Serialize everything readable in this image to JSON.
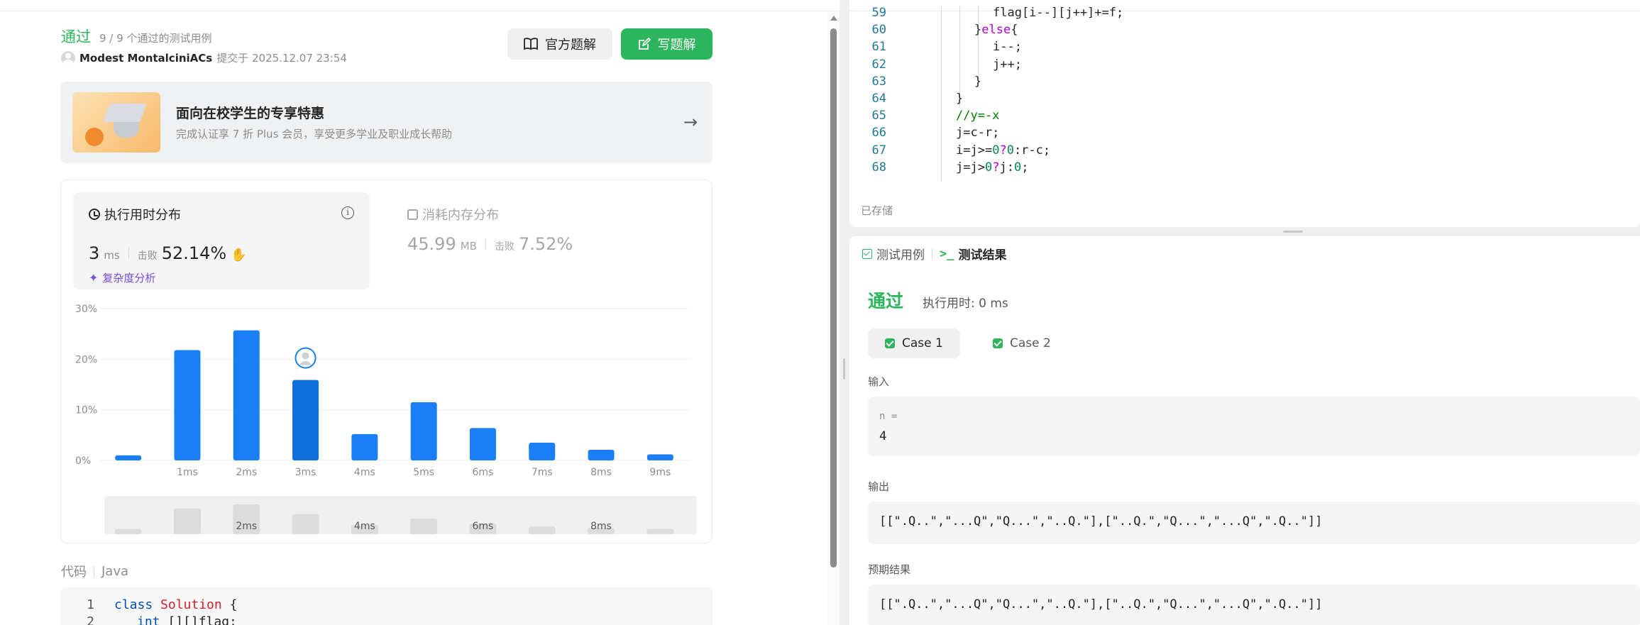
{
  "submission": {
    "status": "通过",
    "cases_summary": "9 / 9 个通过的测试用例",
    "author": "Modest MontalciniACs",
    "submitted_at": "提交于 2025.12.07 23:54",
    "btn_official": "官方题解",
    "btn_write": "写题解"
  },
  "promo": {
    "title": "面向在校学生的专享特惠",
    "subtitle": "完成认证享 7 折 Plus 会员，享受更多学业及职业成长帮助"
  },
  "runtime": {
    "title": "执行用时分布",
    "value": "3",
    "unit": "ms",
    "beat_label": "击败",
    "beat_value": "52.14%",
    "complexity_label": "复杂度分析"
  },
  "memory": {
    "title": "消耗内存分布",
    "value": "45.99",
    "unit": "MB",
    "beat_label": "击败",
    "beat_value": "7.52%"
  },
  "chart_data": {
    "type": "bar",
    "categories": [
      "",
      "1ms",
      "2ms",
      "3ms",
      "4ms",
      "5ms",
      "6ms",
      "7ms",
      "8ms",
      "9ms"
    ],
    "values": [
      1,
      21.8,
      25.7,
      15.9,
      5.2,
      11.5,
      6.4,
      3.5,
      2.1,
      1.2
    ],
    "highlight_index": 3,
    "yticks": [
      "30%",
      "20%",
      "10%",
      "0%"
    ],
    "ylim": [
      0,
      30
    ],
    "grid": true,
    "bar_color": "#1a7ff5",
    "highlight_color": "#0d6fdc",
    "overview": {
      "values": [
        1,
        21.8,
        25.7,
        15.9,
        5.2,
        11.5,
        6.4,
        3.5,
        2.1,
        1.2
      ],
      "labels": [
        "",
        "",
        "2ms",
        "",
        "4ms",
        "",
        "6ms",
        "",
        "8ms",
        ""
      ]
    }
  },
  "code_panel": {
    "title": "代码",
    "language": "Java",
    "lines": [
      {
        "num": "1",
        "kw": "class",
        "cls": "Solution",
        "rest": " {"
      },
      {
        "num": "2",
        "kw": "int",
        "cls": "",
        "rest": " [][]flag;"
      }
    ]
  },
  "editor": {
    "lines": [
      {
        "num": "59",
        "indent": 3,
        "text": "flag[i--][j++]+=f;",
        "type": "plain"
      },
      {
        "num": "60",
        "indent": 2,
        "text": "}else{",
        "type": "else"
      },
      {
        "num": "61",
        "indent": 3,
        "text": "i--;",
        "type": "plain"
      },
      {
        "num": "62",
        "indent": 3,
        "text": "j++;",
        "type": "plain"
      },
      {
        "num": "63",
        "indent": 2,
        "text": "}",
        "type": "plain"
      },
      {
        "num": "64",
        "indent": 1,
        "text": "}",
        "type": "plain"
      },
      {
        "num": "65",
        "indent": 1,
        "text": "//y=-x",
        "type": "comment"
      },
      {
        "num": "66",
        "indent": 1,
        "text": "j=c-r;",
        "type": "plain"
      },
      {
        "num": "67",
        "indent": 1,
        "text": "i=j>=0?0:r-c;",
        "type": "ternary1"
      },
      {
        "num": "68",
        "indent": 1,
        "text": "j=j>0?j:0;",
        "type": "ternary2"
      }
    ],
    "saved_label": "已存储"
  },
  "results": {
    "tab_cases": "测试用例",
    "tab_results": "测试结果",
    "status": "通过",
    "runtime": "执行用时: 0 ms",
    "case1": "Case 1",
    "case2": "Case 2",
    "input_label": "输入",
    "input_name": "n =",
    "input_value": "4",
    "output_label": "输出",
    "output_value": "[[\".Q..\",\"...Q\",\"Q...\",\"..Q.\"],[\"..Q.\",\"Q...\",\"...Q\",\".Q..\"]]",
    "expected_label": "预期结果",
    "expected_value": "[[\".Q..\",\"...Q\",\"Q...\",\"..Q.\"],[\"..Q.\",\"Q...\",\"...Q\",\".Q..\"]]"
  }
}
